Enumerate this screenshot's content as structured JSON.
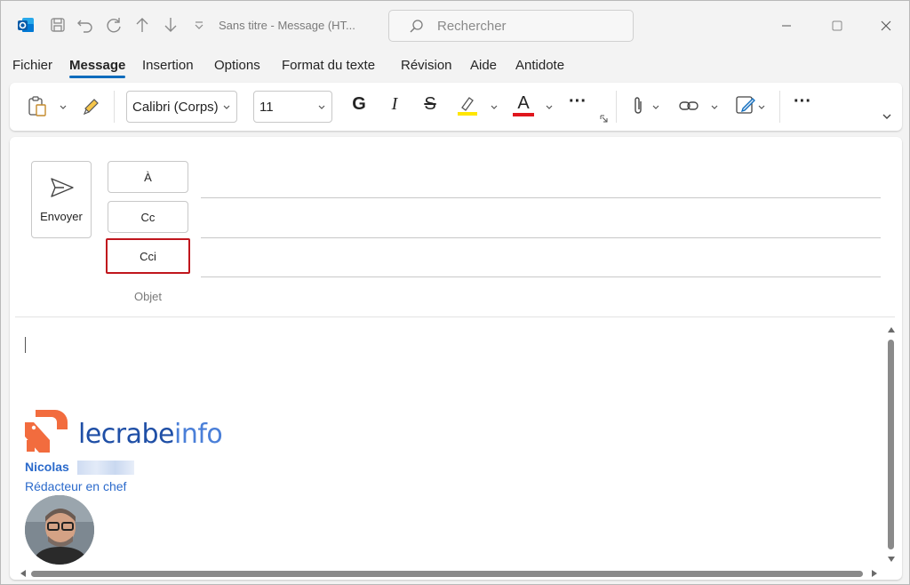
{
  "window": {
    "title": "Sans titre  -  Message (HT...",
    "search_placeholder": "Rechercher"
  },
  "menu": {
    "tabs": [
      "Fichier",
      "Message",
      "Insertion",
      "Options",
      "Format du texte",
      "Révision",
      "Aide",
      "Antidote"
    ],
    "active": "Message"
  },
  "ribbon": {
    "font_name": "Calibri (Corps)",
    "font_size": "11",
    "bold_glyph": "G",
    "italic_glyph": "I",
    "strike_glyph": "S",
    "font_color_glyph": "A",
    "more_glyph": "···",
    "colors": {
      "highlight": "#ffe600",
      "font_color": "#e0161d"
    }
  },
  "compose": {
    "send_label": "Envoyer",
    "to_label": "À",
    "cc_label": "Cc",
    "bcc_label": "Cci",
    "subject_label": "Objet",
    "highlight_color": "#c0161d"
  },
  "signature": {
    "logo_text_main": "lecrabe",
    "logo_text_accent": "info",
    "name": "Nicolas",
    "title": "Rédacteur en chef"
  },
  "colors": {
    "accent": "#0f6cbd",
    "brand_orange": "#f26c3e",
    "link_blue": "#2b6acb"
  }
}
